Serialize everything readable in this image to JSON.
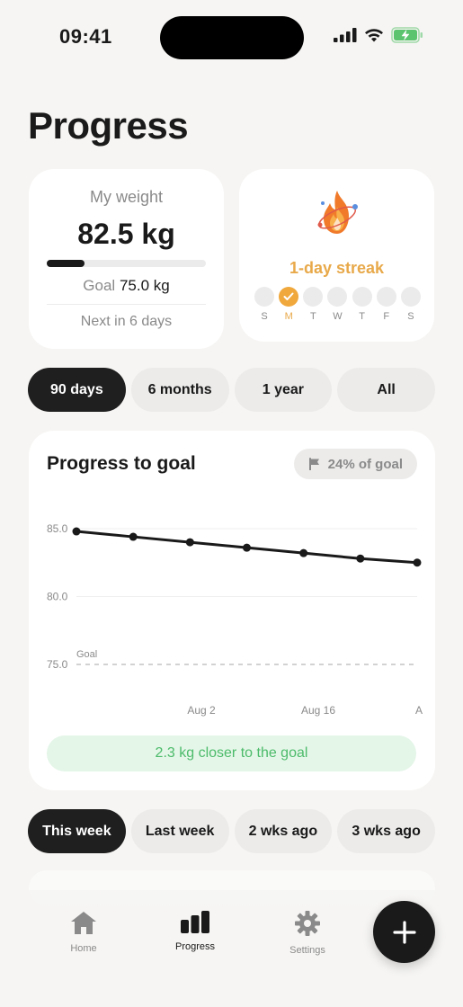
{
  "status": {
    "time": "09:41"
  },
  "page": {
    "title": "Progress"
  },
  "weight_card": {
    "label": "My weight",
    "value": "82.5 kg",
    "progress_fraction": 0.24,
    "goal_label": "Goal",
    "goal_value": "75.0 kg",
    "next": "Next in 6 days"
  },
  "streak_card": {
    "icon": "flame-icon",
    "text": "1-day streak",
    "days": [
      {
        "label": "S",
        "done": false
      },
      {
        "label": "M",
        "done": true
      },
      {
        "label": "T",
        "done": false
      },
      {
        "label": "W",
        "done": false
      },
      {
        "label": "T",
        "done": false
      },
      {
        "label": "F",
        "done": false
      },
      {
        "label": "S",
        "done": false
      }
    ],
    "accent": "#f0a83c"
  },
  "range_tabs": [
    {
      "label": "90 days",
      "active": true
    },
    {
      "label": "6 months",
      "active": false
    },
    {
      "label": "1 year",
      "active": false
    },
    {
      "label": "All",
      "active": false
    }
  ],
  "chart": {
    "title": "Progress to goal",
    "badge": "24% of goal",
    "closer_text": "2.3 kg closer to the goal",
    "closer_color": "#4cbb6a"
  },
  "chart_data": {
    "type": "line",
    "x_ticks": [
      "Aug 2",
      "Aug 16",
      "A"
    ],
    "y_ticks": [
      85.0,
      80.0,
      75.0
    ],
    "y_tick_labels": [
      "85.0",
      "80.0",
      "75.0"
    ],
    "ylim": [
      75.0,
      85.0
    ],
    "goal_line": {
      "value": 75.0,
      "label": "Goal"
    },
    "series": [
      {
        "values": [
          84.8,
          84.4,
          84.0,
          83.6,
          83.2,
          82.8,
          82.5
        ]
      }
    ],
    "grid": true
  },
  "week_tabs": [
    {
      "label": "This week",
      "active": true
    },
    {
      "label": "Last week",
      "active": false
    },
    {
      "label": "2 wks ago",
      "active": false
    },
    {
      "label": "3 wks ago",
      "active": false
    }
  ],
  "tabbar": {
    "items": [
      {
        "label": "Home",
        "icon": "home-icon",
        "active": false
      },
      {
        "label": "Progress",
        "icon": "bar-chart-icon",
        "active": true
      },
      {
        "label": "Settings",
        "icon": "gear-icon",
        "active": false
      }
    ],
    "fab_icon": "plus-icon"
  }
}
